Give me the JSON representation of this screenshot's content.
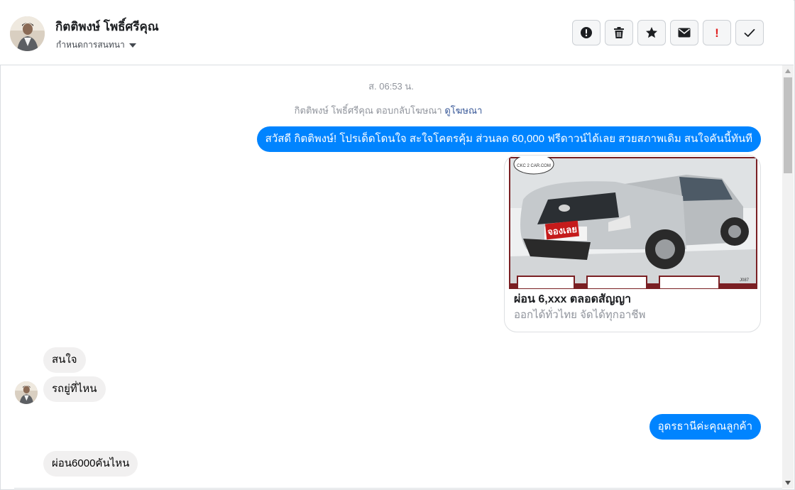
{
  "header": {
    "contact_name": "กิตติพงษ์ โพธิ์ศรีคุณ",
    "assign_label": "กำหนดการสนทนา",
    "actions": [
      {
        "icon": "alert-circle-icon",
        "label": "Mark as spam"
      },
      {
        "icon": "trash-icon",
        "label": "Delete"
      },
      {
        "icon": "star-icon",
        "label": "Star"
      },
      {
        "icon": "envelope-icon",
        "label": "Mark as unread"
      },
      {
        "icon": "exclamation-icon",
        "label": "Mark as important"
      },
      {
        "icon": "checkmark-icon",
        "label": "Mark as done"
      }
    ]
  },
  "conversation": {
    "timestamp": "ส. 06:53 น.",
    "reply_notice": "กิตติพงษ์ โพธิ์ศรีคุณ ตอบกลับโฆษณา",
    "reply_link": "ดูโฆษณา",
    "messages": {
      "greeting": "สวัสดี กิตติพงษ์! โปรเด็ดโดนใจ สะใจโคตรคุ้ม ส่วนลด 60,000 ฟรีดาวน์ได้เลย สวยสภาพเดิม สนใจคันนี้ทันที",
      "in_1": "สนใจ",
      "in_2": "รถยู่ที่ไหน",
      "out_1": "อุดรธานีค่ะคุณลูกค้า",
      "in_3": "ผ่อน6000คันไหน"
    },
    "ad_card": {
      "title": "ผ่อน 6,xxx ตลอดสัญญา",
      "subtitle": "ออกได้ทั่วไทย จัดได้ทุกอาชีพ",
      "image_stamp": "จองเลย",
      "image_logo": "CKC 2 CAR.COM",
      "image_code": "J087"
    }
  },
  "colors": {
    "accent": "#0084ff",
    "incoming_bubble": "#f1f0f0",
    "link": "#385898",
    "muted": "#90949c"
  }
}
